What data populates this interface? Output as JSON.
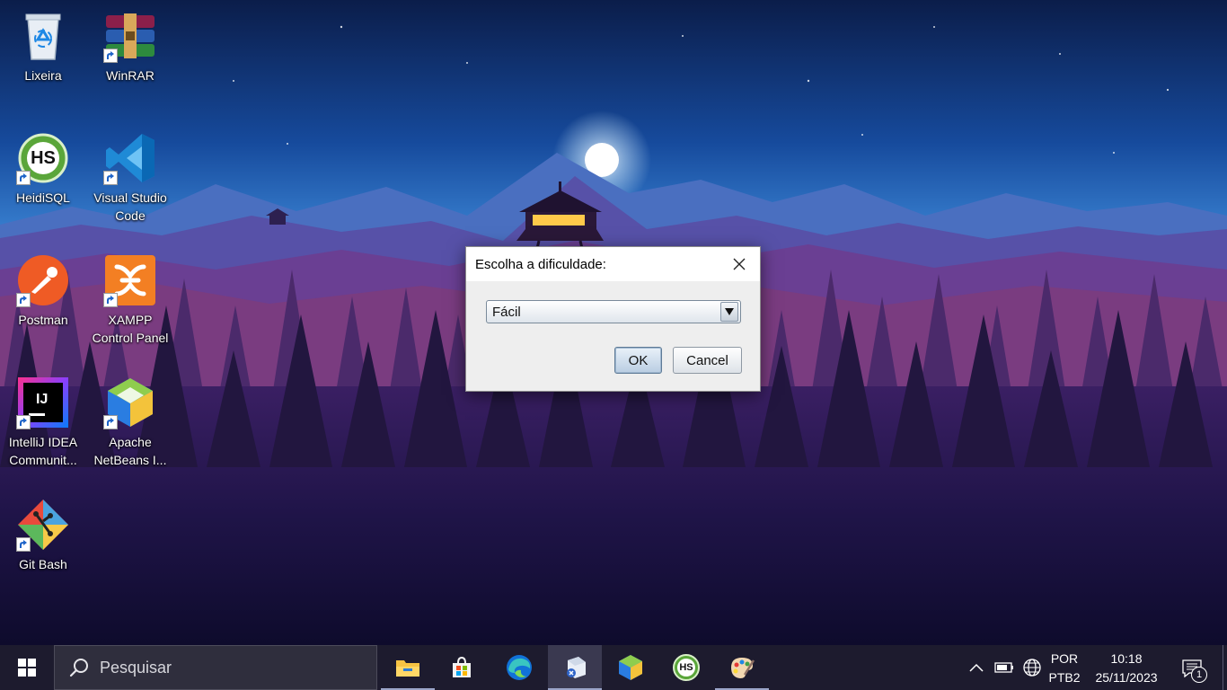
{
  "desktop": {
    "icons": [
      {
        "label": "Lixeira",
        "icon": "recycle-bin-icon"
      },
      {
        "label": "WinRAR",
        "icon": "winrar-icon"
      },
      {
        "label": "HeidiSQL",
        "icon": "heidisql-icon",
        "glyph_text": "HS"
      },
      {
        "label": "Visual Studio Code",
        "icon": "vscode-icon"
      },
      {
        "label": "Postman",
        "icon": "postman-icon"
      },
      {
        "label": "XAMPP Control Panel",
        "icon": "xampp-icon"
      },
      {
        "label": "IntelliJ IDEA Communit...",
        "icon": "intellij-icon",
        "glyph_text": "IJ"
      },
      {
        "label": "Apache NetBeans I...",
        "icon": "netbeans-icon"
      },
      {
        "label": "Git Bash",
        "icon": "git-bash-icon"
      }
    ]
  },
  "dialog": {
    "title": "Escolha a dificuldade:",
    "select_value": "Fácil",
    "ok_label": "OK",
    "cancel_label": "Cancel"
  },
  "taskbar": {
    "search_placeholder": "Pesquisar",
    "apps": [
      {
        "icon": "file-explorer-icon"
      },
      {
        "icon": "microsoft-store-icon"
      },
      {
        "icon": "edge-icon"
      },
      {
        "icon": "java-app-icon",
        "active": true
      },
      {
        "icon": "netbeans-icon"
      },
      {
        "icon": "heidisql-icon",
        "glyph_text": "HS"
      },
      {
        "icon": "paint-icon"
      }
    ],
    "tray": {
      "language_top": "POR",
      "language_bottom": "PTB2",
      "time": "10:18",
      "date": "25/11/2023",
      "notification_count": "1"
    }
  },
  "colors": {
    "taskbar_bg": "#1d1b2e",
    "dialog_bg": "#eeeeee",
    "accent": "#0078d4"
  }
}
